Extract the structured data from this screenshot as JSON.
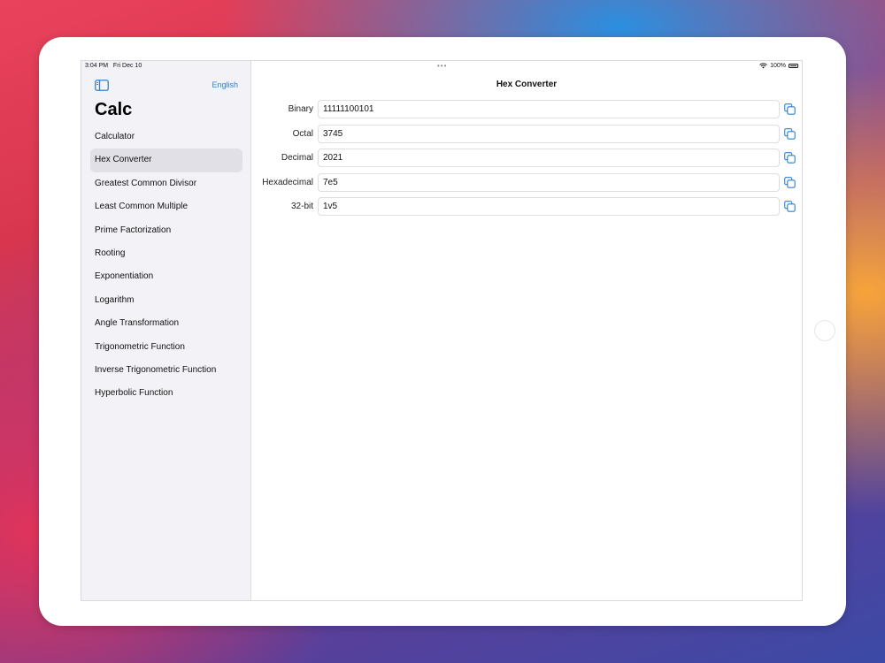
{
  "status_bar": {
    "time": "3:04 PM",
    "date": "Fri Dec 10",
    "battery": "100%"
  },
  "sidebar": {
    "language_label": "English",
    "app_title": "Calc",
    "items": [
      {
        "label": "Calculator"
      },
      {
        "label": "Hex Converter",
        "selected": true
      },
      {
        "label": "Greatest Common Divisor"
      },
      {
        "label": "Least Common Multiple"
      },
      {
        "label": "Prime Factorization"
      },
      {
        "label": "Rooting"
      },
      {
        "label": "Exponentiation"
      },
      {
        "label": "Logarithm"
      },
      {
        "label": "Angle Transformation"
      },
      {
        "label": "Trigonometric Function"
      },
      {
        "label": "Inverse Trigonometric Function"
      },
      {
        "label": "Hyperbolic Function"
      }
    ]
  },
  "detail": {
    "title": "Hex Converter",
    "rows": [
      {
        "label": "Binary",
        "value": "11111100101"
      },
      {
        "label": "Octal",
        "value": "3745"
      },
      {
        "label": "Decimal",
        "value": "2021"
      },
      {
        "label": "Hexadecimal",
        "value": "7e5"
      },
      {
        "label": "32-bit",
        "value": "1v5"
      }
    ]
  },
  "colors": {
    "accent": "#2f80d1",
    "sidebar_bg": "#f2f2f7",
    "selected_bg": "#e0e0e6"
  }
}
